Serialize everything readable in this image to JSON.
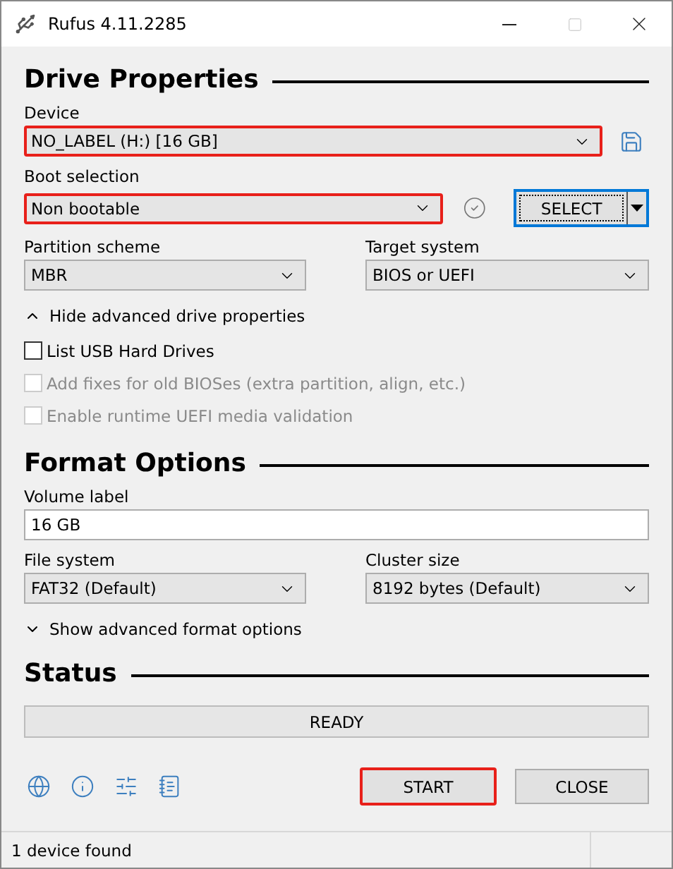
{
  "window": {
    "title": "Rufus 4.11.2285"
  },
  "drive_properties": {
    "heading": "Drive Properties",
    "device": {
      "label": "Device",
      "value": "NO_LABEL (H:) [16 GB]",
      "highlighted": true
    },
    "boot_selection": {
      "label": "Boot selection",
      "value": "Non bootable",
      "highlighted": true,
      "select_button": "SELECT"
    },
    "partition_scheme": {
      "label": "Partition scheme",
      "value": "MBR",
      "highlighted": false
    },
    "target_system": {
      "label": "Target system",
      "value": "BIOS or UEFI",
      "highlighted": false
    },
    "advanced_toggle": {
      "label": "Hide advanced drive properties",
      "expanded": true
    },
    "options": [
      {
        "label": "List USB Hard Drives",
        "checked": false,
        "disabled": false
      },
      {
        "label": "Add fixes for old BIOSes (extra partition, align, etc.)",
        "checked": false,
        "disabled": true
      },
      {
        "label": "Enable runtime UEFI media validation",
        "checked": false,
        "disabled": true
      }
    ]
  },
  "format_options": {
    "heading": "Format Options",
    "volume_label": {
      "label": "Volume label",
      "value": "16 GB"
    },
    "file_system": {
      "label": "File system",
      "value": "FAT32 (Default)",
      "highlighted": false
    },
    "cluster_size": {
      "label": "Cluster size",
      "value": "8192 bytes (Default)",
      "highlighted": false
    },
    "advanced_toggle": {
      "label": "Show advanced format options",
      "expanded": false
    }
  },
  "status": {
    "heading": "Status",
    "progress_text": "READY"
  },
  "buttons": [
    {
      "label": "START",
      "highlighted": true
    },
    {
      "label": "CLOSE",
      "highlighted": false
    }
  ],
  "status_bar": {
    "text": "1 device found"
  }
}
